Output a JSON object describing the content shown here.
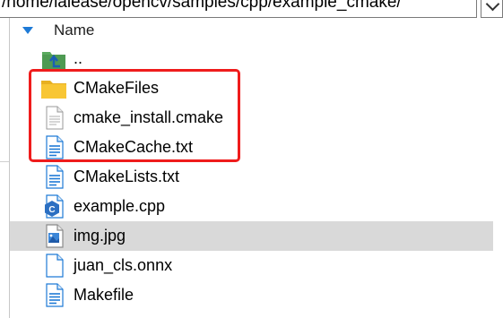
{
  "address_bar": {
    "path": "/home/lalease/opencv/samples/cpp/example_cmake/"
  },
  "file_list": {
    "column_header": "Name",
    "items": [
      {
        "name": "..",
        "icon": "parent-folder-icon",
        "selected": false
      },
      {
        "name": "CMakeFiles",
        "icon": "folder-icon",
        "selected": false
      },
      {
        "name": "cmake_install.cmake",
        "icon": "generic-file-icon",
        "selected": false
      },
      {
        "name": "CMakeCache.txt",
        "icon": "text-file-icon",
        "selected": false
      },
      {
        "name": "CMakeLists.txt",
        "icon": "text-file-icon",
        "selected": false
      },
      {
        "name": "example.cpp",
        "icon": "cpp-file-icon",
        "selected": false
      },
      {
        "name": "img.jpg",
        "icon": "image-file-icon",
        "selected": true
      },
      {
        "name": "juan_cls.onnx",
        "icon": "blank-file-icon",
        "selected": false
      },
      {
        "name": "Makefile",
        "icon": "text-file-icon",
        "selected": false
      }
    ]
  },
  "colors": {
    "highlight": "#ef1c1c",
    "selection": "#d9d9d9",
    "folder": "#f8c634",
    "accent": "#1e7ad6"
  }
}
